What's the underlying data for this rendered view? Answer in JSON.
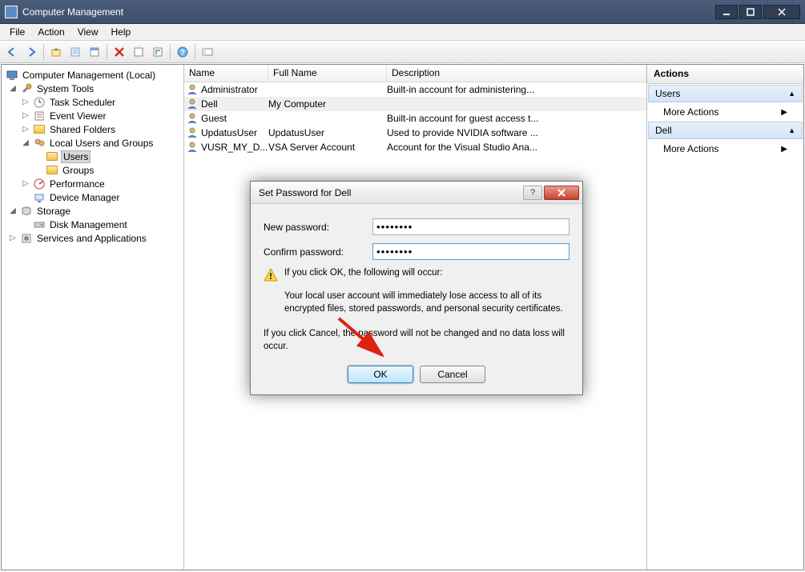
{
  "window_title": "Computer Management",
  "menu": [
    "File",
    "Action",
    "View",
    "Help"
  ],
  "tree": {
    "root": "Computer Management (Local)",
    "system_tools": "System Tools",
    "task_scheduler": "Task Scheduler",
    "event_viewer": "Event Viewer",
    "shared_folders": "Shared Folders",
    "local_users": "Local Users and Groups",
    "users": "Users",
    "groups": "Groups",
    "performance": "Performance",
    "device_manager": "Device Manager",
    "storage": "Storage",
    "disk_management": "Disk Management",
    "services_apps": "Services and Applications"
  },
  "list": {
    "columns": {
      "name": "Name",
      "full": "Full Name",
      "desc": "Description"
    },
    "rows": [
      {
        "name": "Administrator",
        "full": "",
        "desc": "Built-in account for administering..."
      },
      {
        "name": "Dell",
        "full": "My Computer",
        "desc": ""
      },
      {
        "name": "Guest",
        "full": "",
        "desc": "Built-in account for guest access t..."
      },
      {
        "name": "UpdatusUser",
        "full": "UpdatusUser",
        "desc": "Used to provide NVIDIA software ..."
      },
      {
        "name": "VUSR_MY_D...",
        "full": "VSA Server Account",
        "desc": "Account for the Visual Studio Ana..."
      }
    ]
  },
  "actions": {
    "header": "Actions",
    "section1": "Users",
    "more1": "More Actions",
    "section2": "Dell",
    "more2": "More Actions"
  },
  "dialog": {
    "title": "Set Password for Dell",
    "new_pw_label": "New password:",
    "confirm_pw_label": "Confirm password:",
    "new_pw_value": "••••••••",
    "confirm_pw_value": "••••••••",
    "warn_heading": "If you click OK, the following will occur:",
    "warn_body": "Your local user account will immediately lose access to all of its encrypted files, stored passwords, and personal security certificates.",
    "cancel_note": "If you click Cancel, the password will not be changed and no data loss will occur.",
    "ok": "OK",
    "cancel": "Cancel"
  }
}
